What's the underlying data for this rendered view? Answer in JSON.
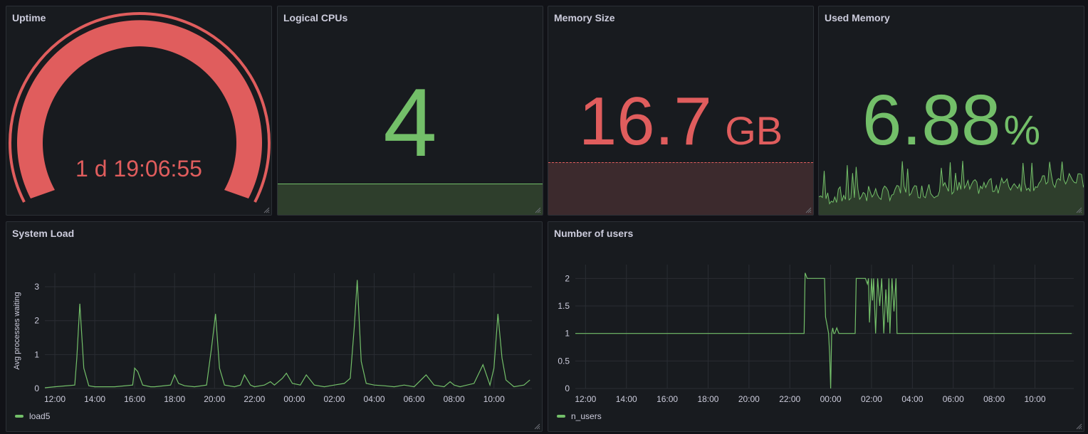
{
  "panels": {
    "uptime": {
      "title": "Uptime",
      "value": "1 d 19:06:55",
      "color": "#e05d5d"
    },
    "cpus": {
      "title": "Logical CPUs",
      "value": "4",
      "color": "#73bf69"
    },
    "memsize": {
      "title": "Memory Size",
      "value": "16.7",
      "unit": "GB",
      "color": "#e05d5d"
    },
    "usedmem": {
      "title": "Used Memory",
      "value": "6.88",
      "unit": "%",
      "color": "#73bf69"
    }
  },
  "chart_data": [
    {
      "type": "line",
      "title": "System Load",
      "ylabel": "Avg processes waiting",
      "xlabel": "",
      "x_ticks": [
        "12:00",
        "14:00",
        "16:00",
        "18:00",
        "20:00",
        "22:00",
        "00:00",
        "02:00",
        "04:00",
        "06:00",
        "08:00",
        "10:00"
      ],
      "y_ticks": [
        "0",
        "1",
        "2",
        "3"
      ],
      "ylim": [
        0,
        3.4
      ],
      "legend": "bottom-left",
      "series": [
        {
          "name": "load5",
          "color": "#73bf69",
          "x": [
            11.5,
            12,
            13,
            13.1,
            13.25,
            13.45,
            13.7,
            14,
            15,
            15.9,
            16.0,
            16.15,
            16.4,
            16.8,
            17,
            17.8,
            18.0,
            18.2,
            18.5,
            19,
            19.6,
            19.85,
            20.05,
            20.25,
            20.5,
            21,
            21.3,
            21.5,
            21.8,
            22,
            22.5,
            22.8,
            23,
            23.4,
            23.6,
            23.9,
            24.3,
            24.6,
            25,
            25.5,
            26,
            26.5,
            26.8,
            27.0,
            27.15,
            27.35,
            27.6,
            28,
            28.5,
            29,
            29.5,
            30,
            30.6,
            31,
            31.5,
            31.8,
            32,
            32.3,
            32.5,
            33,
            33.45,
            33.8,
            34.0,
            34.2,
            34.4,
            34.6,
            35.0,
            35.5,
            35.8
          ],
          "y": [
            0.02,
            0.05,
            0.1,
            0.9,
            2.5,
            0.6,
            0.08,
            0.05,
            0.05,
            0.1,
            0.6,
            0.5,
            0.1,
            0.05,
            0.05,
            0.1,
            0.4,
            0.15,
            0.08,
            0.05,
            0.1,
            1.2,
            2.2,
            0.6,
            0.1,
            0.05,
            0.1,
            0.4,
            0.1,
            0.05,
            0.1,
            0.2,
            0.1,
            0.3,
            0.45,
            0.15,
            0.1,
            0.4,
            0.1,
            0.05,
            0.1,
            0.15,
            0.3,
            1.8,
            3.2,
            0.8,
            0.15,
            0.1,
            0.08,
            0.05,
            0.1,
            0.05,
            0.4,
            0.1,
            0.05,
            0.2,
            0.1,
            0.05,
            0.08,
            0.15,
            0.7,
            0.1,
            0.6,
            2.2,
            0.9,
            0.25,
            0.05,
            0.1,
            0.25
          ]
        }
      ]
    },
    {
      "type": "line",
      "title": "Number of users",
      "ylabel": "",
      "xlabel": "",
      "x_ticks": [
        "12:00",
        "14:00",
        "16:00",
        "18:00",
        "20:00",
        "22:00",
        "00:00",
        "02:00",
        "04:00",
        "06:00",
        "08:00",
        "10:00"
      ],
      "y_ticks": [
        "0",
        "0.5",
        "1",
        "1.5",
        "2"
      ],
      "ylim": [
        0,
        2.25
      ],
      "legend": "bottom-left",
      "series": [
        {
          "name": "n_users",
          "color": "#73bf69",
          "x": [
            11.5,
            22.7,
            22.75,
            22.85,
            22.9,
            23.7,
            23.75,
            23.85,
            23.9,
            23.95,
            24.0,
            24.05,
            24.1,
            24.15,
            24.2,
            24.3,
            24.4,
            24.5,
            25.2,
            25.25,
            25.3,
            25.7,
            25.8,
            25.85,
            25.9,
            26.0,
            26.05,
            26.1,
            26.2,
            26.3,
            26.4,
            26.5,
            26.6,
            26.7,
            26.8,
            26.85,
            26.9,
            27.0,
            27.1,
            27.2,
            27.25,
            27.3,
            27.35,
            27.4,
            35.8
          ],
          "y": [
            1,
            1,
            2.1,
            2,
            2,
            2,
            1.3,
            1.1,
            1.0,
            0.6,
            0.0,
            1.0,
            1.1,
            1.0,
            1.0,
            1.1,
            1.0,
            1.0,
            1.0,
            2.0,
            2.0,
            2.0,
            1.9,
            2.0,
            1.2,
            2.0,
            1.6,
            2.0,
            1.0,
            2.0,
            1.5,
            2.0,
            1.0,
            1.8,
            1.2,
            2.0,
            1.0,
            2.0,
            1.4,
            2.0,
            1.0,
            1.0,
            1.0,
            1.0,
            1.0
          ]
        }
      ]
    }
  ]
}
